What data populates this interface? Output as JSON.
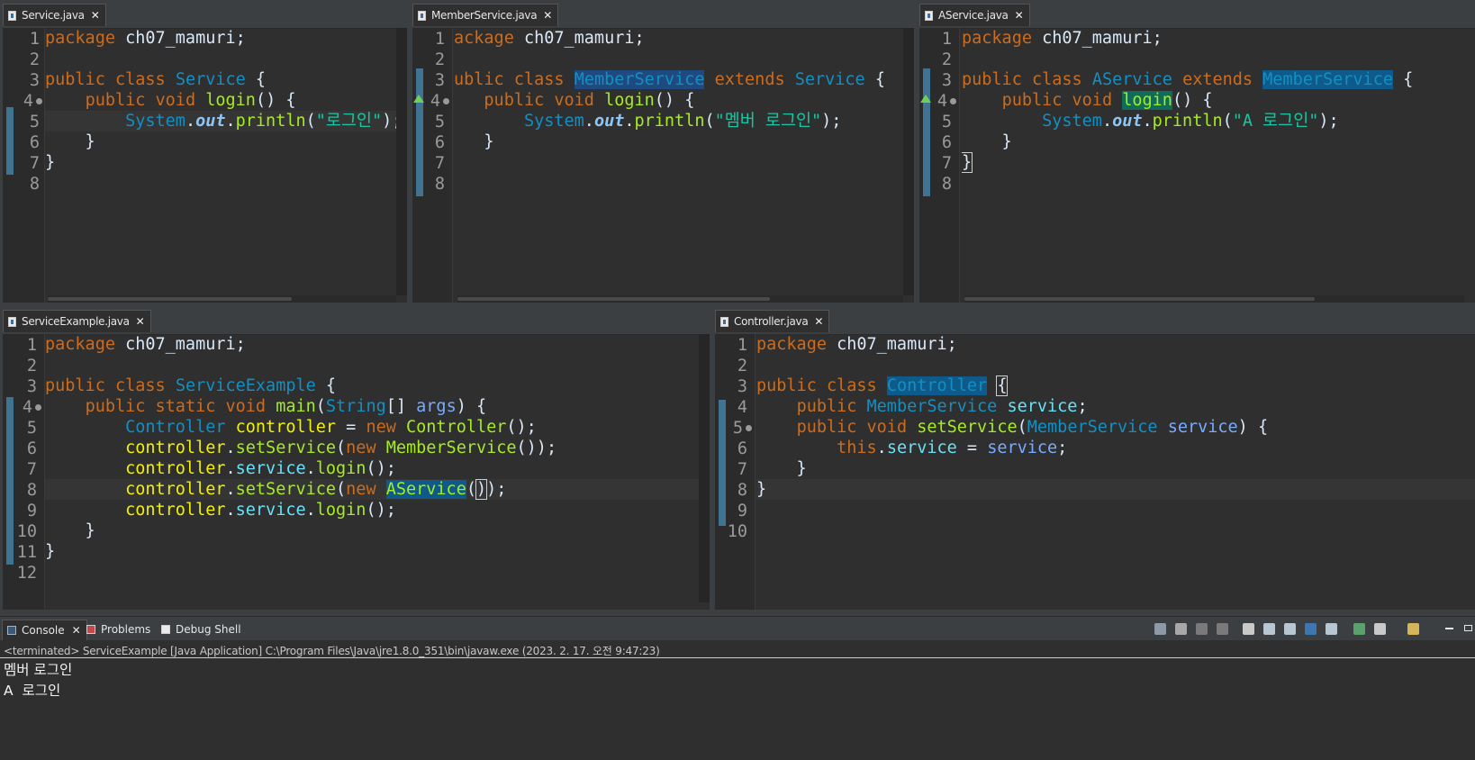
{
  "editors": {
    "service": {
      "tab": "Service.java",
      "lines": [
        "1",
        "2",
        "3",
        "4",
        "5",
        "6",
        "7",
        "8"
      ]
    },
    "member": {
      "tab": "MemberService.java",
      "lines": [
        "1",
        "2",
        "3",
        "4",
        "5",
        "6",
        "7",
        "8"
      ]
    },
    "aservice": {
      "tab": "AService.java",
      "lines": [
        "1",
        "2",
        "3",
        "4",
        "5",
        "6",
        "7",
        "8"
      ]
    },
    "example": {
      "tab": "ServiceExample.java",
      "lines": [
        "1",
        "2",
        "3",
        "4",
        "5",
        "6",
        "7",
        "8",
        "9",
        "10",
        "11",
        "12"
      ]
    },
    "controller": {
      "tab": "Controller.java",
      "lines": [
        "1",
        "2",
        "3",
        "4",
        "5",
        "6",
        "7",
        "8",
        "9",
        "10"
      ]
    }
  },
  "console": {
    "tabs": [
      "Console",
      "Problems",
      "Debug Shell"
    ],
    "status": "<terminated> ServiceExample [Java Application] C:\\Program Files\\Java\\jre1.8.0_351\\bin\\javaw.exe (2023. 2. 17. 오전 9:47:23)",
    "output": [
      "멤버 로그인",
      "A  로그인"
    ]
  },
  "icons": [
    "java-file-icon",
    "close-icon",
    "console-icon",
    "problems-icon",
    "debug-shell-icon"
  ],
  "colors": {
    "keyword": "#cc6c1d",
    "type": "#1290c3",
    "method": "#a7ec21",
    "string": "#17c6a3",
    "field": "#66e1f8",
    "background": "#2f2f2f"
  }
}
